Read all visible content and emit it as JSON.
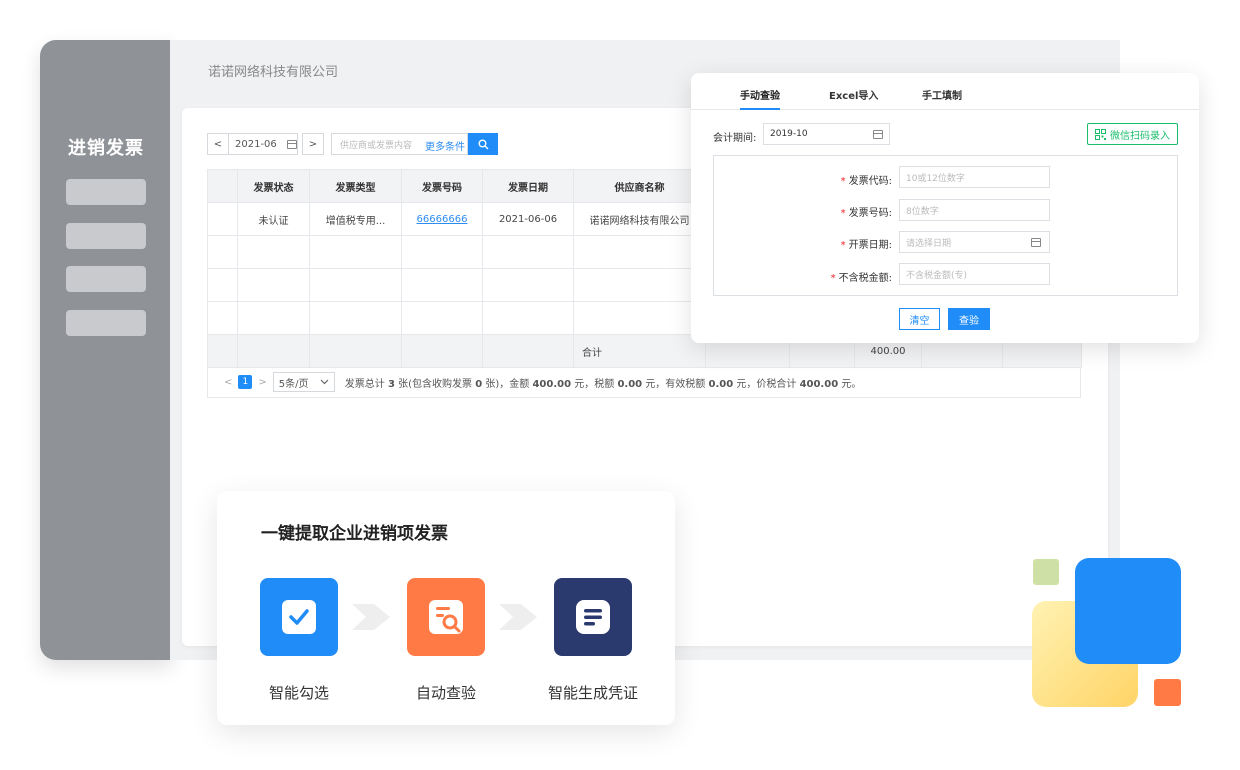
{
  "sidebar": {
    "title": "进销发票"
  },
  "header": {
    "company": "诺诺网络科技有限公司"
  },
  "toolbar": {
    "prev": "<",
    "period": "2021-06",
    "next": ">",
    "search_placeholder": "供应商或发票内容",
    "more_conditions": "更多条件"
  },
  "table": {
    "columns": [
      "发票状态",
      "发票类型",
      "发票号码",
      "发票日期",
      "供应商名称"
    ],
    "rows": [
      {
        "status": "未认证",
        "type": "增值税专用...",
        "number": "66666666",
        "date": "2021-06-06",
        "supplier": "诺诺网络科技有限公司"
      }
    ],
    "sum_label": "合计",
    "sum_value": "400.00"
  },
  "pagination": {
    "prev": "<",
    "current": "1",
    "next": ">",
    "page_size": "5条/页",
    "summary_prefix": "发票总计",
    "count": "3",
    "summary_mid1": "张(包含收购发票",
    "purchase_count": "0",
    "summary_mid2": "张)，金额",
    "amount": "400.00",
    "summary_mid3": "元，税额",
    "tax": "0.00",
    "summary_mid4": "元，有效税额",
    "valid_tax": "0.00",
    "summary_mid5": "元，价税合计",
    "total": "400.00",
    "summary_end": "元。"
  },
  "popup": {
    "tabs": [
      "手动查验",
      "Excel导入",
      "手工填制"
    ],
    "period_label": "会计期间:",
    "period_value": "2019-10",
    "scan_button": "微信扫码录入",
    "fields": [
      {
        "label": "发票代码:",
        "placeholder": "10或12位数字"
      },
      {
        "label": "发票号码:",
        "placeholder": "8位数字"
      },
      {
        "label": "开票日期:",
        "placeholder": "请选择日期"
      },
      {
        "label": "不含税金额:",
        "placeholder": "不含税金额(专)"
      }
    ],
    "required_mark": "*",
    "clear_button": "清空",
    "check_button": "查验"
  },
  "feature": {
    "title": "一键提取企业进销项发票",
    "steps": [
      {
        "label": "智能勾选",
        "icon": "checkbox-icon",
        "color": "#1f8cf7"
      },
      {
        "label": "自动查验",
        "icon": "document-search-icon",
        "color": "#ff7a45"
      },
      {
        "label": "智能生成凭证",
        "icon": "document-lines-icon",
        "color": "#2b3a6e"
      }
    ]
  },
  "colors": {
    "primary": "#1f8cf7",
    "success": "#19be6b",
    "danger": "#f5222d",
    "sidebar": "#8f9297"
  }
}
